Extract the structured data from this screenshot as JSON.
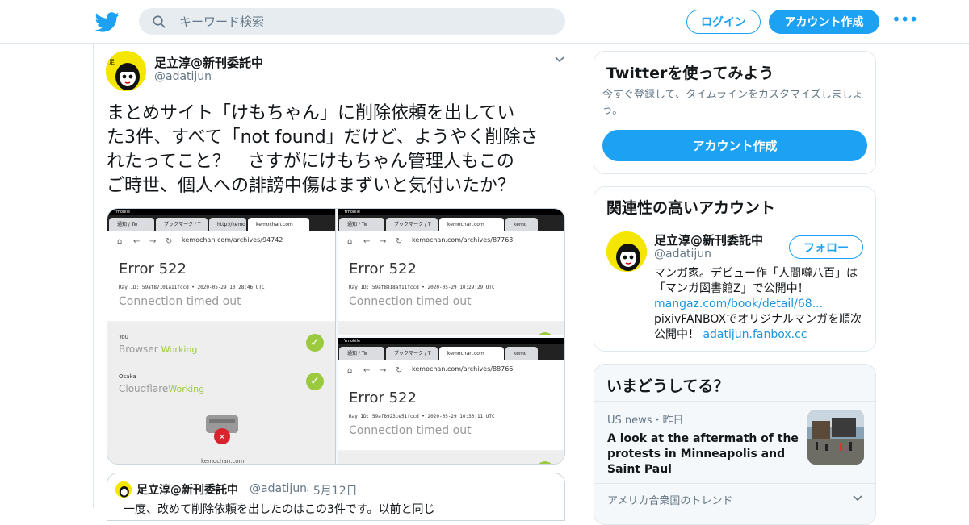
{
  "header": {
    "search_placeholder": "キーワード検索",
    "login_label": "ログイン",
    "signup_label": "アカウント作成",
    "more_label": "•••"
  },
  "tweet": {
    "author_name": "足立淳@新刊委託中",
    "author_handle": "@adatijun",
    "text_lines": [
      "まとめサイト「けもちゃん」に削除依頼を出してい",
      "た3件、すべて「not found」だけど、ようやく削除さ",
      "れたってこと？　さすがにけもちゃん管理人もこの",
      "ご時世、個人への誹謗中傷はまずいと気付いたか？"
    ],
    "media": {
      "left": {
        "tabs": [
          "通知 / Tw",
          "ブックマーク / T",
          "http://kemo",
          "kemochan.com"
        ],
        "url": "kemochan.com/archives/94742",
        "error_title": "Error 522",
        "ray": "Ray ID: 59af87101a11fccd • 2020-05-29 10:28:46 UTC",
        "message": "Connection timed out",
        "you_label": "You",
        "browser_label": "Browser",
        "browser_status": "Working",
        "osaka_label": "Osaka",
        "cloudflare_label": "Cloudflare",
        "cloudflare_status": "Working",
        "domain": "kemochan.com"
      },
      "right_top": {
        "tabs": [
          "通知 / Tw",
          "ブックマーク / T",
          "kemochan.com",
          "kemo"
        ],
        "url": "kemochan.com/archives/87763",
        "error_title": "Error 522",
        "ray": "Ray ID: 59af8818af11fccd • 2020-05-29 10:29:29 UTC",
        "message": "Connection timed out"
      },
      "right_bottom": {
        "tabs": [
          "通知 / Tw",
          "ブックマーク / T",
          "kemochan.com",
          "kemo"
        ],
        "url": "kemochan.com/archives/88766",
        "error_title": "Error 522",
        "ray": "Ray ID: 59af8923ce51fccd • 2020-05-29 10:30:11 UTC",
        "message": "Connection timed out"
      }
    },
    "quote": {
      "author_name": "足立淳@新刊委託中",
      "author_handle": "@adatijun",
      "date": "· 5月12日",
      "text": "一度、改めて削除依頼を出したのはこの3件です。以前と同じ"
    }
  },
  "sidebar": {
    "try_title": "Twitterを使ってみよう",
    "try_desc": "今すぐ登録して、タイムラインをカスタマイズしましょう。",
    "try_button": "アカウント作成",
    "related_title": "関連性の高いアカウント",
    "related_name": "足立淳@新刊委託中",
    "related_handle": "@adatijun",
    "follow_label": "フォロー",
    "bio_1": "マンガ家。デビュー作「人間噂八百」は「マンガ図書館Z」で公開中！",
    "bio_link1": "mangaz.com/book/detail/68...",
    "bio_2": " pixivFANBOXでオリジナルマンガを順次公開中！ ",
    "bio_link2": "adatijun.fanbox.cc",
    "trends_title": "いまどうしてる？",
    "news_source": "US news・昨日",
    "news_headline": "A look at the aftermath of the protests in Minneapolis and Saint Paul",
    "trend_region": "アメリカ合衆国のトレンド"
  },
  "colors": {
    "accent": "#1da1f2",
    "text": "#14171a",
    "muted": "#657786",
    "working": "#9bca3e",
    "error_red": "#d9232e"
  }
}
